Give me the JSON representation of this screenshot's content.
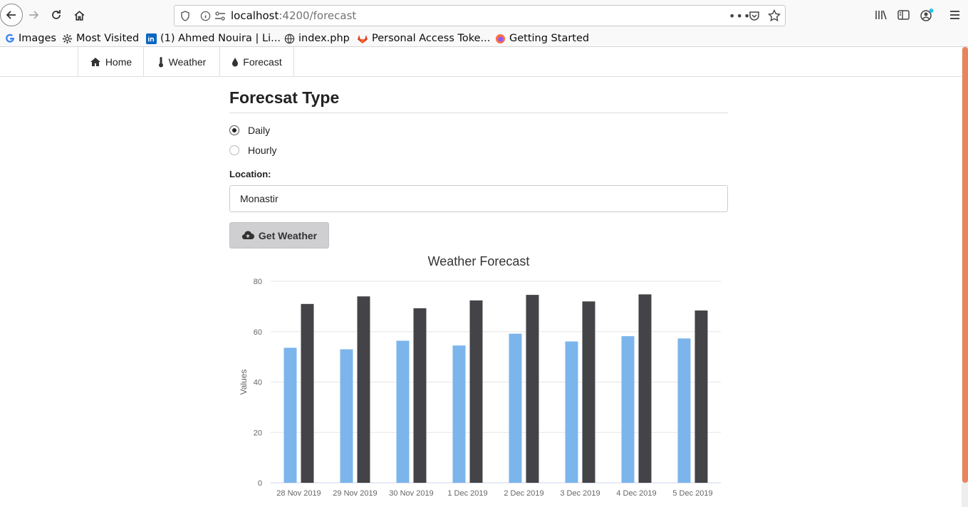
{
  "browser": {
    "url_host": "localhost",
    "url_rest": ":4200/forecast",
    "bookmarks": [
      {
        "label": "Images",
        "icon": "google-icon"
      },
      {
        "label": "Most Visited",
        "icon": "gear-icon"
      },
      {
        "label": "(1) Ahmed Nouira | Li...",
        "icon": "linkedin-icon"
      },
      {
        "label": "index.php",
        "icon": "globe-icon"
      },
      {
        "label": "Personal Access Toke...",
        "icon": "gitlab-icon"
      },
      {
        "label": "Getting Started",
        "icon": "firefox-icon"
      }
    ]
  },
  "nav": {
    "items": [
      {
        "label": "Home",
        "icon": "home-icon"
      },
      {
        "label": "Weather",
        "icon": "thermometer-icon"
      },
      {
        "label": "Forecast",
        "icon": "droplet-icon"
      }
    ]
  },
  "form": {
    "title": "Forecsat Type",
    "options": [
      {
        "label": "Daily",
        "checked": true
      },
      {
        "label": "Hourly",
        "checked": false
      }
    ],
    "location_label": "Location:",
    "location_value": "Monastir",
    "button_label": "Get Weather"
  },
  "colors": {
    "series_a": "#7cb5ec",
    "series_b": "#434348"
  },
  "chart_data": {
    "type": "bar",
    "title": "Weather Forecast",
    "ylabel": "Values",
    "xlabel": "",
    "ylim": [
      0,
      80
    ],
    "yticks": [
      0,
      20,
      40,
      60,
      80
    ],
    "grid": true,
    "categories": [
      "28 Nov 2019",
      "29 Nov 2019",
      "30 Nov 2019",
      "1 Dec 2019",
      "2 Dec 2019",
      "3 Dec 2019",
      "4 Dec 2019",
      "5 Dec 2019"
    ],
    "series": [
      {
        "values": [
          53.6,
          53.0,
          56.4,
          54.5,
          59.2,
          56.1,
          58.2,
          57.3
        ]
      },
      {
        "values": [
          71.0,
          74.0,
          69.3,
          72.4,
          74.6,
          72.0,
          74.8,
          68.4
        ]
      }
    ]
  }
}
